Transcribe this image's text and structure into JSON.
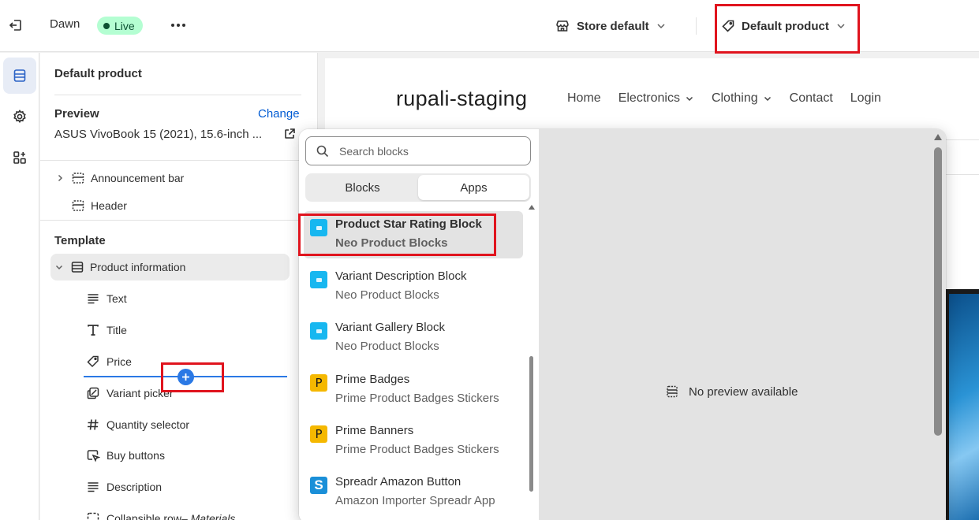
{
  "topbar": {
    "theme_name": "Dawn",
    "status_badge": "Live",
    "store_selector": "Store default",
    "template_selector": "Default product"
  },
  "panel": {
    "title": "Default product",
    "preview_label": "Preview",
    "change_label": "Change",
    "preview_product": "ASUS VivoBook 15 (2021), 15.6-inch ...",
    "header_sections": [
      {
        "label": "Announcement bar",
        "icon": "section-icon"
      },
      {
        "label": "Header",
        "icon": "section-icon"
      }
    ],
    "template_label": "Template",
    "product_information": "Product information",
    "blocks": [
      {
        "label": "Text",
        "icon": "text-lines-icon"
      },
      {
        "label": "Title",
        "icon": "title-t-icon"
      },
      {
        "label": "Price",
        "icon": "price-tag-icon"
      },
      {
        "label": "Variant picker",
        "icon": "variant-icon"
      },
      {
        "label": "Quantity selector",
        "icon": "hash-icon"
      },
      {
        "label": "Buy buttons",
        "icon": "cursor-click-icon"
      },
      {
        "label": "Description",
        "icon": "text-lines-icon"
      },
      {
        "label": "Collapsible row",
        "icon": "collapsible-icon"
      }
    ],
    "collapsible_suffix": " – Materials"
  },
  "storefront": {
    "shop_name": "rupali-staging",
    "nav": [
      {
        "label": "Home",
        "dropdown": false
      },
      {
        "label": "Electronics",
        "dropdown": true
      },
      {
        "label": "Clothing",
        "dropdown": true
      },
      {
        "label": "Contact",
        "dropdown": false
      },
      {
        "label": "Login",
        "dropdown": false
      }
    ]
  },
  "add_block_popover": {
    "search_placeholder": "Search blocks",
    "tabs": [
      "Blocks",
      "Apps"
    ],
    "active_tab": "Apps",
    "items": [
      {
        "name": "Product Star Rating Block",
        "app": "Neo Product Blocks",
        "icon": "neo",
        "selected": true
      },
      {
        "name": "Variant Description Block",
        "app": "Neo Product Blocks",
        "icon": "neo",
        "selected": false
      },
      {
        "name": "Variant Gallery Block",
        "app": "Neo Product Blocks",
        "icon": "neo",
        "selected": false
      },
      {
        "name": "Prime Badges",
        "app": "Prime Product Badges Stickers",
        "icon": "prime",
        "icon_text": "P",
        "selected": false
      },
      {
        "name": "Prime Banners",
        "app": "Prime Product Badges Stickers",
        "icon": "prime",
        "icon_text": "P",
        "selected": false
      },
      {
        "name": "Spreadr Amazon Button",
        "app": "Amazon Importer Spreadr App",
        "icon": "spreadr",
        "icon_text": "S",
        "selected": false
      }
    ],
    "no_preview_text": "No preview available"
  },
  "colors": {
    "accent_blue": "#2b79e5",
    "link_blue": "#005bd3",
    "highlight_red": "#e0141e",
    "live_green_bg": "#b4fed2",
    "neo_icon": "#17b7f0",
    "prime_icon": "#f5b800"
  }
}
